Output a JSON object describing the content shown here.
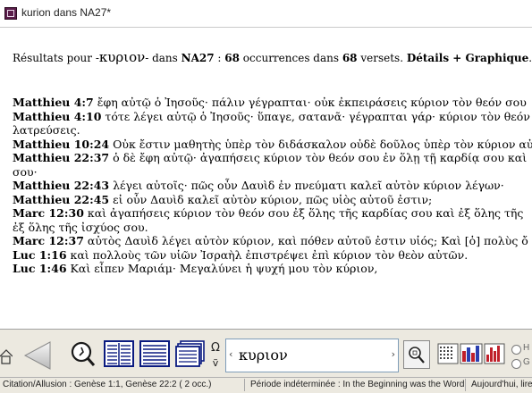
{
  "window": {
    "title": "kurion dans NA27*"
  },
  "summary": {
    "prefix": "Résultats pour -",
    "term": "κυριον",
    "mid1": "- dans ",
    "corpus": "NA27",
    "mid2": " : ",
    "occurrences": "68",
    "mid3": " occurrences dans ",
    "verses": "68",
    "mid4": " versets. ",
    "links": "Détails + Graphique",
    "ellipsis": "..."
  },
  "verses": [
    {
      "ref": "Matthieu 4:7",
      "text": "ἔφη αὐτῷ ὁ Ἰησοῦς· πάλιν γέγραπται· οὐκ ἐκπειράσεις κύριον τὸν θεόν σου"
    },
    {
      "ref": "Matthieu 4:10",
      "text": "τότε λέγει αὐτῷ ὁ Ἰησοῦς· ὕπαγε, σατανᾶ· γέγραπται γάρ· κύριον τὸν θεόν"
    },
    {
      "ref": "",
      "text": "λατρεύσεις."
    },
    {
      "ref": "Matthieu 10:24",
      "text": "Οὐκ ἔστιν μαθητὴς ὑπὲρ τὸν διδάσκαλον οὐδὲ δοῦλος ὑπὲρ τὸν κύριον αὐ"
    },
    {
      "ref": "Matthieu 22:37",
      "text": "ὁ δὲ ἔφη αὐτῷ· ἀγαπήσεις κύριον τὸν θεόν σου ἐν ὅλῃ τῇ καρδίᾳ σου καὶ"
    },
    {
      "ref": "",
      "text": "σου·"
    },
    {
      "ref": "Matthieu 22:43",
      "text": "λέγει αὐτοῖς· πῶς οὖν Δαυὶδ ἐν πνεύματι καλεῖ αὐτὸν κύριον λέγων·"
    },
    {
      "ref": "Matthieu 22:45",
      "text": "εἰ οὖν Δαυὶδ καλεῖ αὐτὸν κύριον, πῶς υἱὸς αὐτοῦ ἐστιν;"
    },
    {
      "ref": "Marc 12:30",
      "text": "καὶ ἀγαπήσεις κύριον τὸν θεόν σου ἐξ ὅλης τῆς καρδίας σου καὶ ἐξ ὅλης τῆς"
    },
    {
      "ref": "",
      "text": "ἐξ ὅλης τῆς ἰσχύος σου."
    },
    {
      "ref": "Marc 12:37",
      "text": "αὐτὸς Δαυὶδ λέγει αὐτὸν κύριον, καὶ πόθεν αὐτοῦ ἐστιν υἱός; Καὶ [ὁ] πολὺς ὄ"
    },
    {
      "ref": "Luc 1:16",
      "text": "καὶ πολλοὺς τῶν υἱῶν Ἰσραὴλ ἐπιστρέψει ἐπὶ κύριον τὸν θεὸν αὐτῶν."
    },
    {
      "ref": "Luc 1:46",
      "text": "Καὶ εἶπεν Μαριάμ· Μεγαλύνει ἡ ψυχή μου τὸν κύριον,"
    }
  ],
  "toolbar": {
    "omega": "Ω",
    "search_value": "κυριον",
    "radio_h": "H",
    "radio_g": "G"
  },
  "status": {
    "citation": "Citation/Allusion : Genèse 1:1, Genèse 22:2 ( 2 occ.)",
    "period": "Période indéterminée : In the Beginning was the Word",
    "today": "Aujourd'hui, lire"
  }
}
